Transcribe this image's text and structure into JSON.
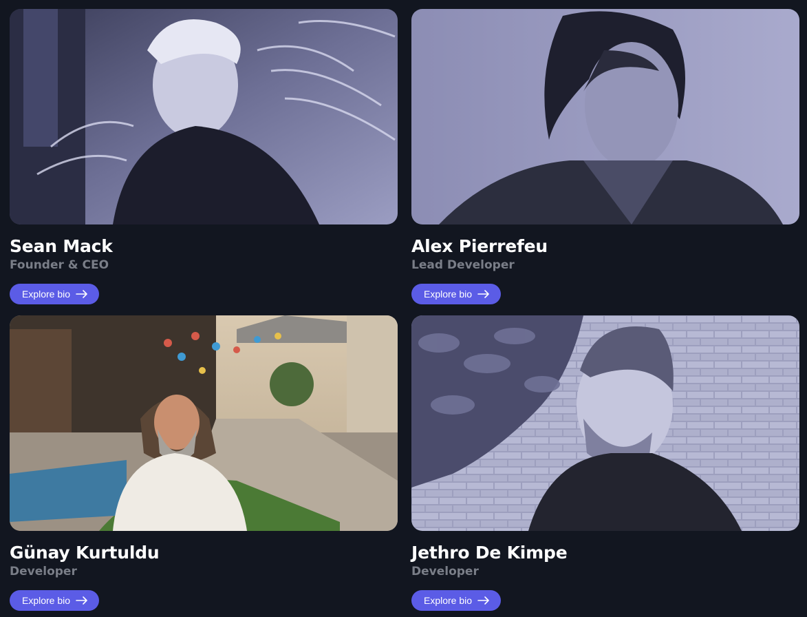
{
  "team": [
    {
      "name": "Sean Mack",
      "role": "Founder & CEO",
      "button_label": "Explore bio"
    },
    {
      "name": "Alex Pierrefeu",
      "role": "Lead Developer",
      "button_label": "Explore bio"
    },
    {
      "name": "Günay Kurtuldu",
      "role": "Developer",
      "button_label": "Explore bio"
    },
    {
      "name": "Jethro De Kimpe",
      "role": "Developer",
      "button_label": "Explore bio"
    }
  ],
  "colors": {
    "background": "#121620",
    "accent": "#5b5ce6",
    "role_text": "#7a7e88"
  },
  "icons": [
    "arrow-right-icon"
  ]
}
